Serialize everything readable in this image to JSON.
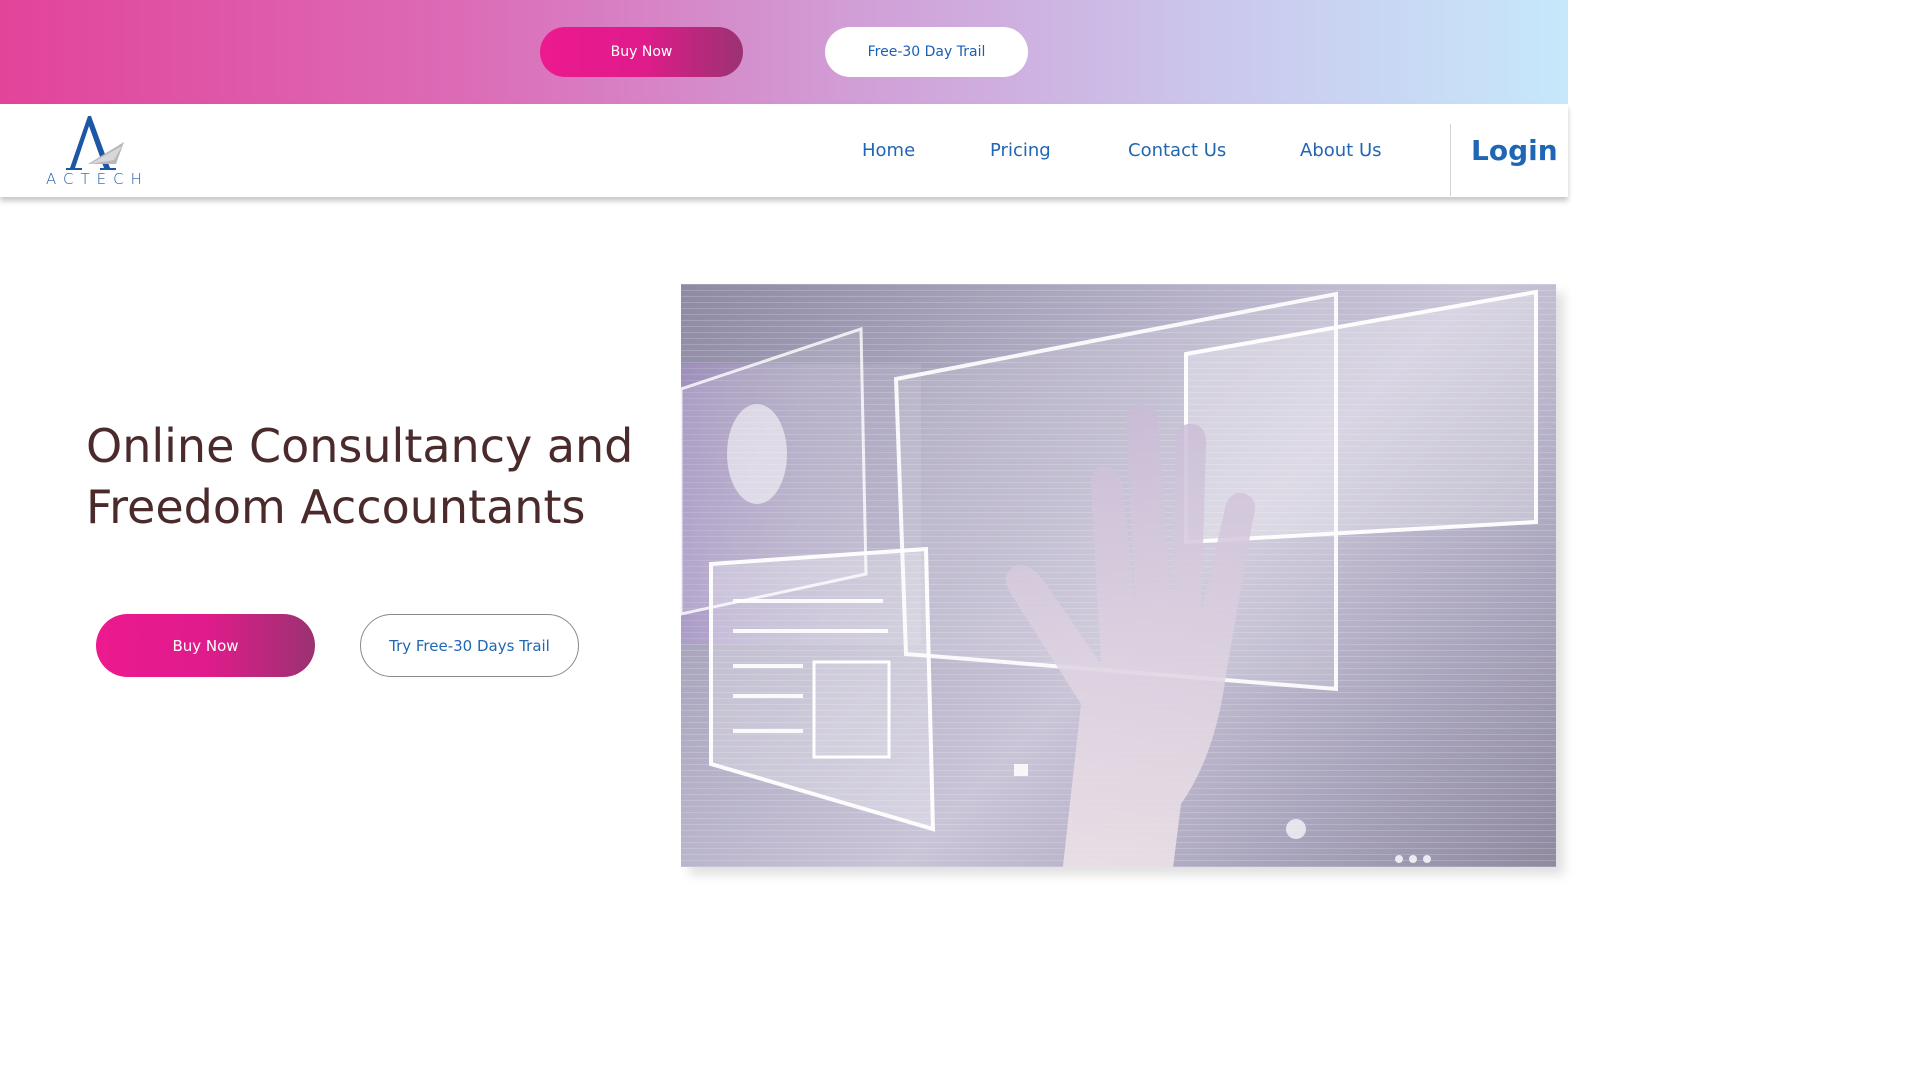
{
  "promo_bar": {
    "buy_label": "Buy Now",
    "trial_label": "Free-30 Day Trail"
  },
  "navbar": {
    "logo_text": "ACTECH",
    "links": [
      {
        "label": "Home"
      },
      {
        "label": "Pricing"
      },
      {
        "label": "Contact Us"
      },
      {
        "label": "About Us"
      }
    ],
    "login_label": "Login"
  },
  "hero": {
    "title_line1": "Online Consultancy and",
    "title_line2": "Freedom Accountants",
    "buy_label": "Buy Now",
    "trial_label": "Try Free-30 Days Trail"
  },
  "colors": {
    "brand_pink": "#ec1a8e",
    "brand_purple": "#9b3272",
    "link_blue": "#2166b3",
    "title_brown": "#4a2a2b"
  },
  "icons": {
    "logo": "actech-logo-icon"
  }
}
